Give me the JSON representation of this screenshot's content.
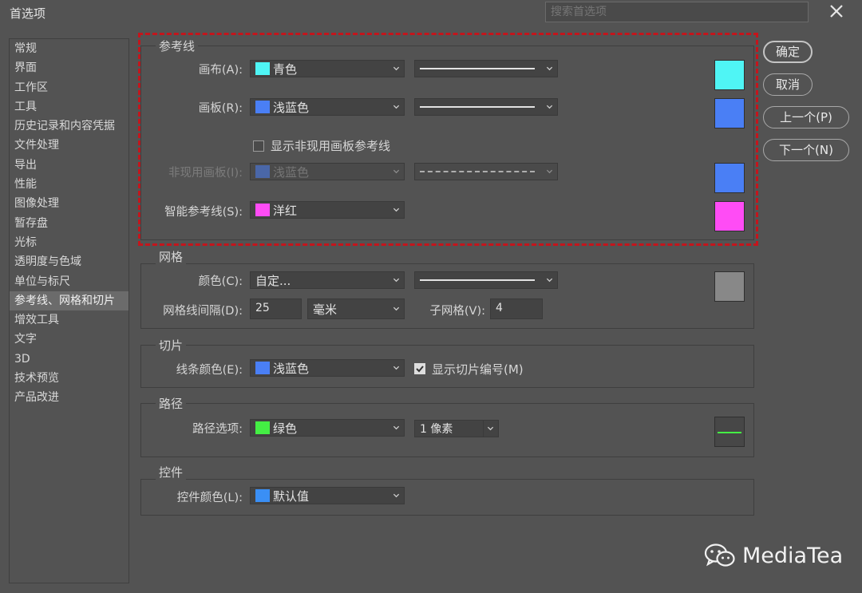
{
  "window": {
    "title": "首选项",
    "search_placeholder": "搜索首选项"
  },
  "sidebar": {
    "items": [
      "常规",
      "界面",
      "工作区",
      "工具",
      "历史记录和内容凭据",
      "文件处理",
      "导出",
      "性能",
      "图像处理",
      "暂存盘",
      "光标",
      "透明度与色域",
      "单位与标尺",
      "参考线、网格和切片",
      "增效工具",
      "文字",
      "3D",
      "技术预览",
      "产品改进"
    ],
    "active_index": 13
  },
  "guides": {
    "title": "参考线",
    "canvas": {
      "label": "画布(A):",
      "color": "青色",
      "swatch": "#4ff5f5"
    },
    "artboard": {
      "label": "画板(R):",
      "color": "浅蓝色",
      "swatch": "#4a7ff5"
    },
    "show_inactive": {
      "label": "显示非现用画板参考线",
      "checked": false
    },
    "inactive": {
      "label": "非现用画板(I):",
      "color": "浅蓝色",
      "swatch": "#4a7ff5"
    },
    "smart": {
      "label": "智能参考线(S):",
      "color": "洋红",
      "swatch": "#ff4cf5"
    }
  },
  "grid": {
    "title": "网格",
    "color": {
      "label": "颜色(C):",
      "value": "自定...",
      "swatch": "#888888"
    },
    "spacing": {
      "label": "网格线间隔(D):",
      "value": "25",
      "unit": "毫米"
    },
    "subdiv": {
      "label": "子网格(V):",
      "value": "4"
    }
  },
  "slices": {
    "title": "切片",
    "line_color": {
      "label": "线条颜色(E):",
      "value": "浅蓝色",
      "swatch": "#4a7ff5"
    },
    "show_numbers": {
      "label": "显示切片编号(M)",
      "checked": true
    }
  },
  "paths": {
    "title": "路径",
    "options": {
      "label": "路径选项:",
      "color": "绿色",
      "swatch": "#44ee44",
      "width": "1 像素"
    }
  },
  "controls": {
    "title": "控件",
    "color": {
      "label": "控件颜色(L):",
      "value": "默认值",
      "swatch": "#3a8ff5"
    }
  },
  "buttons": {
    "ok": "确定",
    "cancel": "取消",
    "prev": "上一个(P)",
    "next": "下一个(N)"
  },
  "watermark": {
    "text": "MediaTea"
  }
}
